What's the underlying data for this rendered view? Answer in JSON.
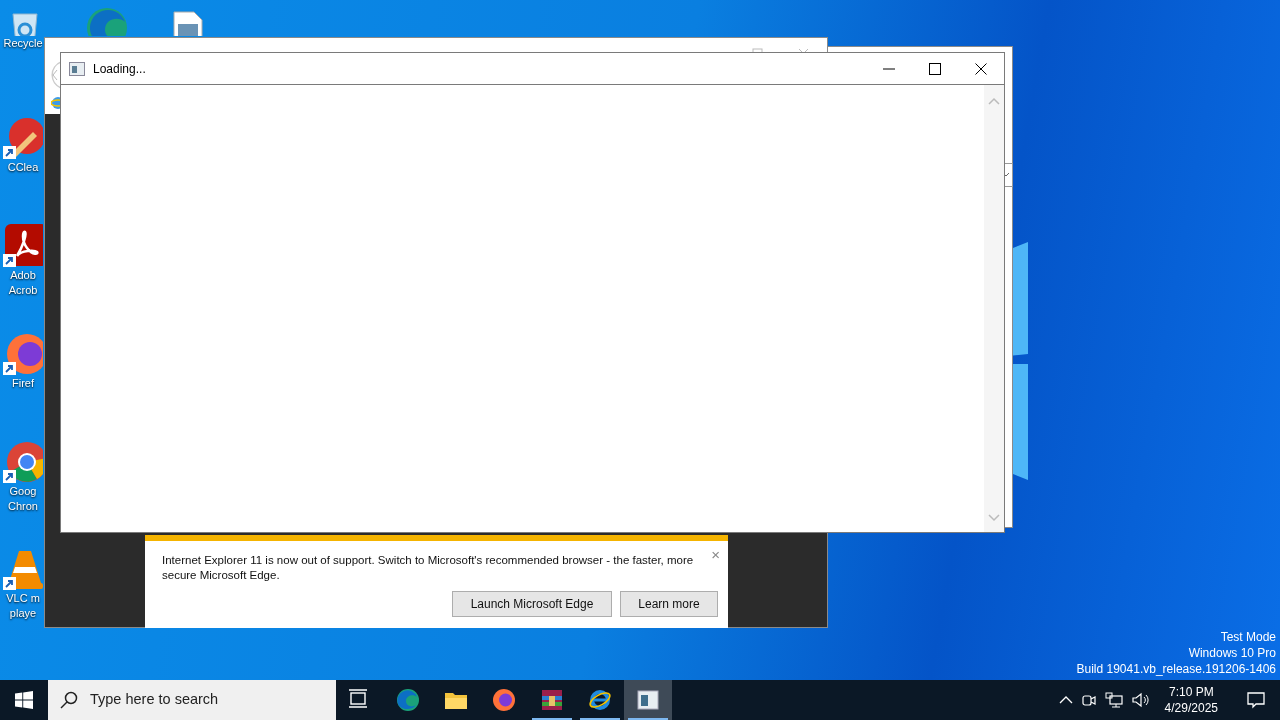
{
  "desktop_icons": [
    {
      "kind": "recycle-bin",
      "label_lines": [
        "Recycle"
      ]
    },
    {
      "kind": "edge"
    },
    {
      "kind": "image-file"
    },
    {
      "kind": "ccleaner",
      "label_lines": [
        "CClea"
      ],
      "shortcut": true
    },
    {
      "kind": "acrobat",
      "label_lines": [
        "Adob",
        "Acrob"
      ],
      "shortcut": true
    },
    {
      "kind": "firefox",
      "label_lines": [
        "Firef"
      ],
      "shortcut": true
    },
    {
      "kind": "chrome",
      "label_lines": [
        "Goog",
        "Chron"
      ],
      "shortcut": true
    },
    {
      "kind": "vlc",
      "label_lines": [
        "VLC m",
        "playe"
      ],
      "shortcut": true
    }
  ],
  "dialog": {
    "title": "Loading..."
  },
  "ie_window": {
    "notification": {
      "message": "Internet Explorer 11 is now out of support. Switch to Microsoft's recommended browser - the faster, more secure Microsoft Edge.",
      "close": "×",
      "buttons": [
        "Launch Microsoft Edge",
        "Learn more"
      ]
    }
  },
  "system_notice": [
    "Test Mode",
    "Windows 10 Pro",
    "Build 19041.vb_release.191206-1406"
  ],
  "taskbar": {
    "search": {
      "placeholder": "Type here to search"
    },
    "apps": [
      {
        "kind": "task-view",
        "running": false,
        "selected": false
      },
      {
        "kind": "edge",
        "running": false,
        "selected": false
      },
      {
        "kind": "explorer",
        "running": false,
        "selected": false
      },
      {
        "kind": "firefox",
        "running": false,
        "selected": false
      },
      {
        "kind": "winrar",
        "running": true,
        "selected": false
      },
      {
        "kind": "ie",
        "running": true,
        "selected": false
      },
      {
        "kind": "app-window",
        "running": true,
        "selected": true
      }
    ],
    "tray": {
      "time": "7:10 PM",
      "date": "4/29/2025"
    }
  }
}
